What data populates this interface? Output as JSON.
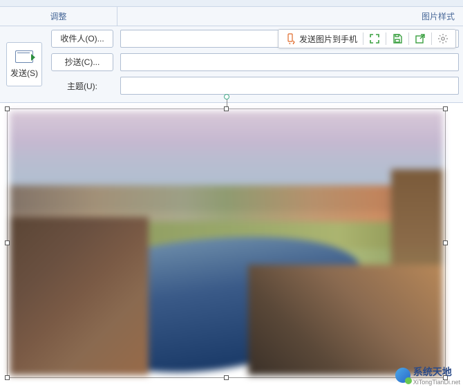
{
  "ribbon": {
    "group_left": "调整",
    "group_right": "图片样式"
  },
  "toolbar": {
    "send_to_phone": "发送图片到手机",
    "icons": {
      "phone": "phone-sync-icon",
      "fullscreen": "fullscreen-icon",
      "save": "save-icon",
      "share": "share-icon",
      "settings": "gear-icon"
    },
    "colors": {
      "phone": "#e06a2a",
      "fullscreen": "#3aa040",
      "save": "#3aa040",
      "share": "#3aa040",
      "settings": "#888888"
    }
  },
  "compose": {
    "send_label": "发送(S)",
    "to_label": "收件人(O)...",
    "cc_label": "抄送(C)...",
    "subject_label": "主题(U):",
    "to_value": "",
    "cc_value": "",
    "subject_value": ""
  },
  "watermark": {
    "line1": "系统天地",
    "line2": "XiTongTianDi.net"
  }
}
